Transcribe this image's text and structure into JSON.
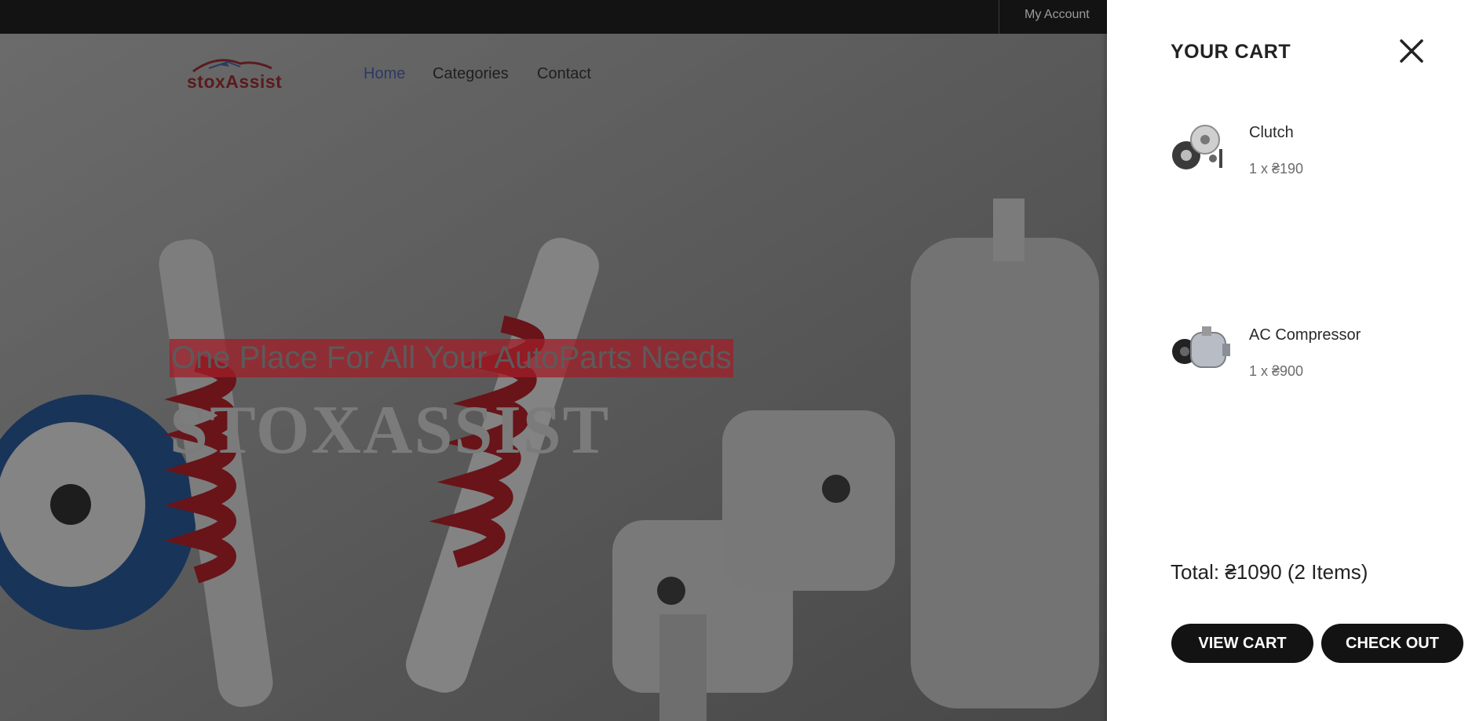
{
  "topbar": {
    "account_label": "My Account"
  },
  "header": {
    "logo_text": "stoxAssist",
    "nav": [
      {
        "label": "Home",
        "active": true
      },
      {
        "label": "Categories",
        "active": false
      },
      {
        "label": "Contact",
        "active": false
      }
    ]
  },
  "hero": {
    "tagline": "One Place For All Your AutoParts Needs",
    "brand": "STOXASSIST"
  },
  "cart": {
    "title": "YOUR CART",
    "items": [
      {
        "name": "Clutch",
        "qty_price": "1 x ₴190",
        "image_icon": "clutch-kit-icon"
      },
      {
        "name": "AC Compressor",
        "qty_price": "1 x ₴900",
        "image_icon": "ac-compressor-icon"
      }
    ],
    "total": "Total: ₴1090 (2 Items)",
    "view_cart_label": "VIEW CART",
    "checkout_label": "CHECK OUT"
  },
  "colors": {
    "drawer_bg": "#ffffff",
    "button_bg": "#131313",
    "tagline_highlight": "#a01e28",
    "nav_active": "#2c3a63"
  }
}
